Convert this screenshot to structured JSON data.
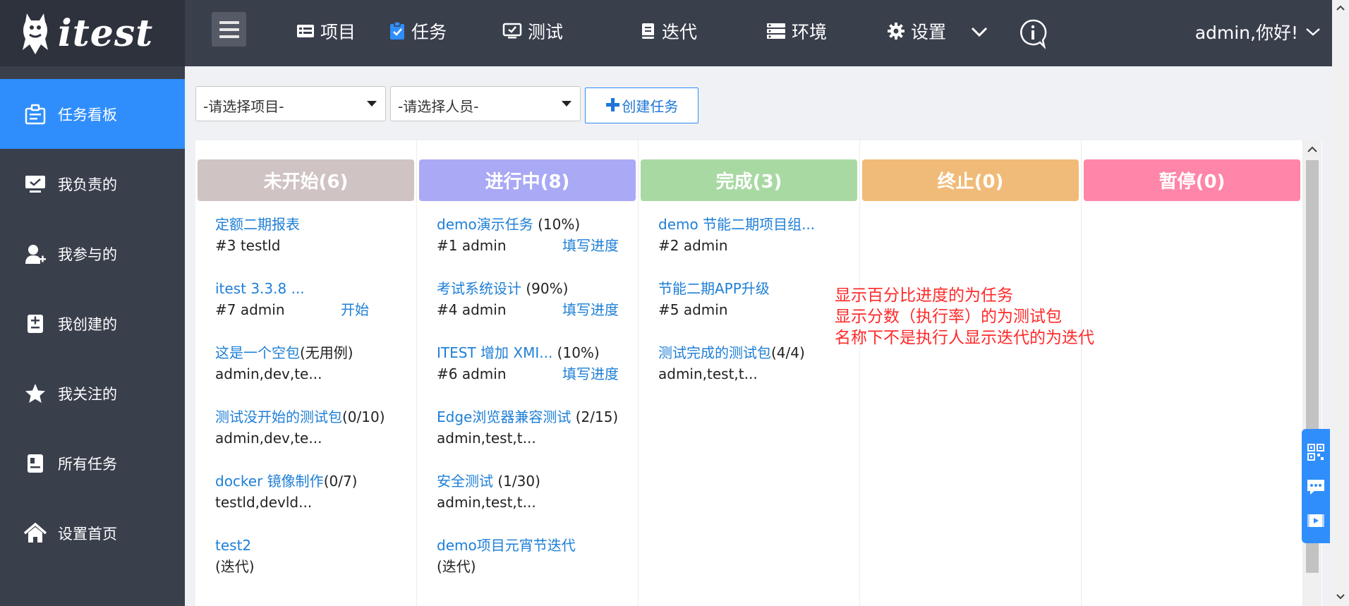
{
  "app": {
    "name": "itest"
  },
  "nav": [
    {
      "label": "项目",
      "icon": "project-icon"
    },
    {
      "label": "任务",
      "icon": "task-icon"
    },
    {
      "label": "测试",
      "icon": "test-icon"
    },
    {
      "label": "迭代",
      "icon": "iteration-icon"
    },
    {
      "label": "环境",
      "icon": "environment-icon"
    },
    {
      "label": "设置",
      "icon": "gear-icon"
    }
  ],
  "user": {
    "greeting": "admin,你好!"
  },
  "sidebar": {
    "items": [
      {
        "label": "任务看板",
        "icon": "board-icon"
      },
      {
        "label": "我负责的",
        "icon": "monitor-icon"
      },
      {
        "label": "我参与的",
        "icon": "user-add-icon"
      },
      {
        "label": "我创建的",
        "icon": "document-add-icon"
      },
      {
        "label": "我关注的",
        "icon": "star-icon"
      },
      {
        "label": "所有任务",
        "icon": "list-icon"
      },
      {
        "label": "设置首页",
        "icon": "home-icon"
      }
    ]
  },
  "filters": {
    "project": "-请选择项目-",
    "person": "-请选择人员-",
    "create_label": "创建任务"
  },
  "colors": {
    "accent": "#2f8efc",
    "link": "#1e7fd6",
    "note": "#ff2a2a"
  },
  "columns": [
    {
      "header": "未开始(6)",
      "color": "#d0c3c4",
      "cards": [
        {
          "link": "定额二期报表",
          "extra": "",
          "sub": "#3 testld",
          "action": ""
        },
        {
          "link": "itest 3.3.8 ...",
          "extra": "",
          "sub": "#7 admin",
          "action": "开始"
        },
        {
          "link": "这是一个空包",
          "extra": "(无用例)",
          "sub": "admin,dev,te...",
          "action": ""
        },
        {
          "link": "测试没开始的测试包",
          "extra": "(0/10)",
          "sub": "admin,dev,te...",
          "action": ""
        },
        {
          "link": "docker 镜像制作",
          "extra": "(0/7)",
          "sub": "testld,devld...",
          "action": ""
        },
        {
          "link": "test2",
          "extra": "",
          "sub": "(迭代)",
          "action": ""
        }
      ]
    },
    {
      "header": "进行中(8)",
      "color": "#a9a9f5",
      "cards": [
        {
          "link": "demo演示任务",
          "extra": " (10%)",
          "sub": "#1 admin",
          "action": "填写进度"
        },
        {
          "link": "考试系统设计",
          "extra": " (90%)",
          "sub": "#4 admin",
          "action": "填写进度"
        },
        {
          "link": "ITEST 增加 XMI...",
          "extra": " (10%)",
          "sub": "#6 admin",
          "action": "填写进度"
        },
        {
          "link": "Edge浏览器兼容测试",
          "extra": " (2/15)",
          "sub": "admin,test,t...",
          "action": ""
        },
        {
          "link": "安全测试",
          "extra": " (1/30)",
          "sub": "admin,test,t...",
          "action": ""
        },
        {
          "link": "demo项目元宵节迭代",
          "extra": "",
          "sub": "(迭代)",
          "action": ""
        }
      ]
    },
    {
      "header": "完成(3)",
      "color": "#a9d9a3",
      "cards": [
        {
          "link": "demo 节能二期项目组...",
          "extra": "",
          "sub": "#2 admin",
          "action": ""
        },
        {
          "link": "节能二期APP升级",
          "extra": "",
          "sub": "#5 admin",
          "action": ""
        },
        {
          "link": "测试完成的测试包",
          "extra": "(4/4)",
          "sub": "admin,test,t...",
          "action": ""
        }
      ]
    },
    {
      "header": "终止(0)",
      "color": "#f0bb78",
      "cards": []
    },
    {
      "header": "暂停(0)",
      "color": "#ff86a8",
      "cards": []
    }
  ],
  "note": [
    "显示百分比进度的为任务",
    "显示分数（执行率）的为测试包",
    "名称下不是执行人显示迭代的为迭代"
  ]
}
